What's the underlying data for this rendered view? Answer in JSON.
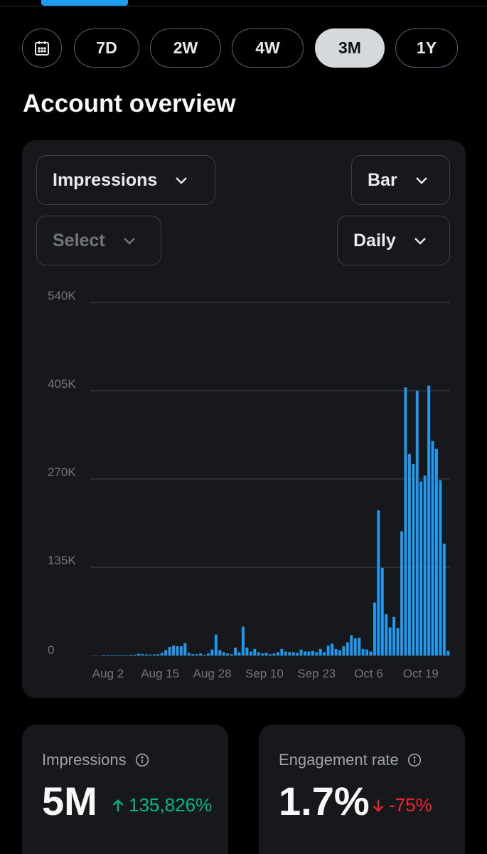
{
  "ranges": [
    {
      "label": "7D",
      "active": false
    },
    {
      "label": "2W",
      "active": false
    },
    {
      "label": "4W",
      "active": false
    },
    {
      "label": "3M",
      "active": true
    },
    {
      "label": "1Y",
      "active": false
    }
  ],
  "calendar_icon": "calendar-icon",
  "heading": "Account overview",
  "controls": {
    "metric": "Impressions",
    "chart_type": "Bar",
    "compare": "Select",
    "interval": "Daily"
  },
  "chart_data": {
    "type": "bar",
    "title": "",
    "xlabel": "",
    "ylabel": "",
    "ylim": [
      0,
      540000
    ],
    "ytick_labels": [
      "0",
      "135K",
      "270K",
      "405K",
      "540K"
    ],
    "xtick_labels": [
      "Aug 2",
      "Aug 15",
      "Aug 28",
      "Sep 10",
      "Sep 23",
      "Oct 6",
      "Oct 19"
    ],
    "grid": true,
    "color": "#1d9bf0",
    "series": [
      {
        "values": [
          0,
          0,
          0,
          500,
          300,
          200,
          300,
          200,
          300,
          100,
          1000,
          1200,
          2500,
          2000,
          1500,
          1500,
          1500,
          2000,
          4000,
          8000,
          13000,
          15000,
          14000,
          14000,
          19000,
          4000,
          2000,
          2000,
          3000,
          1000,
          3000,
          9000,
          32000,
          8000,
          5000,
          3000,
          2000,
          12000,
          5000,
          44000,
          12000,
          6000,
          10000,
          5000,
          3000,
          4000,
          2000,
          3000,
          5000,
          10000,
          6000,
          5000,
          5000,
          4000,
          9000,
          6000,
          6000,
          7000,
          5000,
          10000,
          5000,
          15000,
          18000,
          10000,
          8000,
          14000,
          20000,
          31000,
          26000,
          27000,
          10000,
          9000,
          6000,
          81000,
          222000,
          134000,
          63000,
          43000,
          59000,
          42000,
          190000,
          410000,
          308000,
          293000,
          405000,
          266000,
          275000,
          413000,
          328000,
          316000,
          268000,
          171000,
          7000
        ]
      }
    ]
  },
  "stats": [
    {
      "label": "Impressions",
      "value": "5M",
      "delta": "135,826%",
      "direction": "up",
      "color": "#00ba7c"
    },
    {
      "label": "Engagement rate",
      "value": "1.7%",
      "delta": "-75%",
      "direction": "down",
      "color": "#f4212e"
    }
  ]
}
